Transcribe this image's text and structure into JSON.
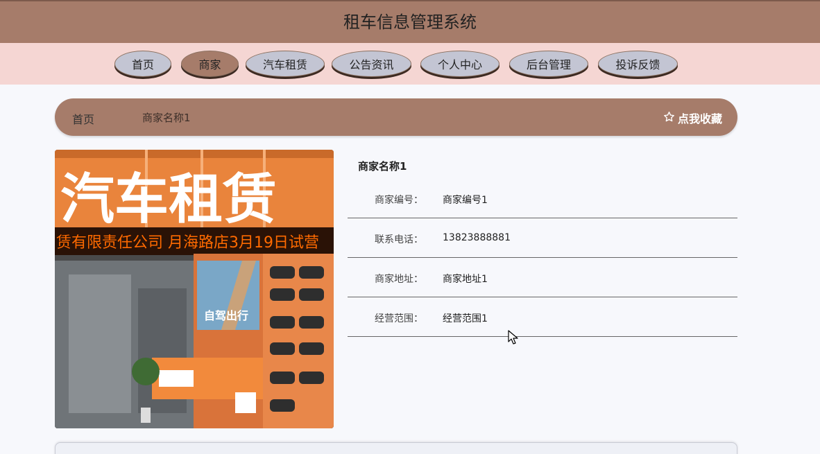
{
  "app": {
    "title": "租车信息管理系统"
  },
  "nav": {
    "items": [
      {
        "label": "首页",
        "active": false
      },
      {
        "label": "商家",
        "active": true
      },
      {
        "label": "汽车租赁",
        "active": false
      },
      {
        "label": "公告资讯",
        "active": false
      },
      {
        "label": "个人中心",
        "active": false
      },
      {
        "label": "后台管理",
        "active": false
      },
      {
        "label": "投诉反馈",
        "active": false
      }
    ]
  },
  "breadcrumb": {
    "home": "首页",
    "current": "商家名称1",
    "favorite": "点我收藏",
    "favorite_icon": "star-outline-icon"
  },
  "detail": {
    "name": "商家名称1",
    "fields": [
      {
        "label": "商家编号：",
        "value": "商家编号1"
      },
      {
        "label": "联系电话：",
        "value": "13823888881"
      },
      {
        "label": "商家地址：",
        "value": "商家地址1"
      },
      {
        "label": "经营范围：",
        "value": "经营范围1"
      }
    ]
  },
  "photo": {
    "sign_text": "汽车租赁",
    "led_text": "赁有限责任公司 月海路店3月19日试营",
    "poster_text": "自驾出行"
  },
  "colors": {
    "header": "#a67c6a",
    "nav_bg": "#f5d6d3",
    "nav_button": "#c3c5d3",
    "page_bg": "#f7f8fc"
  }
}
